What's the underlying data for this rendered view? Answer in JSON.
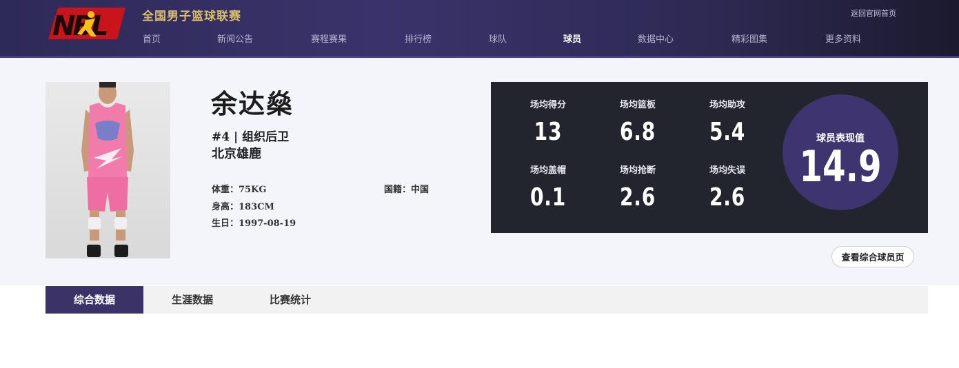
{
  "header": {
    "league_title": "全国男子篮球联赛",
    "back_link": "返回官网首页",
    "nav": [
      {
        "label": "首页",
        "active": false
      },
      {
        "label": "新闻公告",
        "active": false
      },
      {
        "label": "赛程赛果",
        "active": false
      },
      {
        "label": "排行榜",
        "active": false
      },
      {
        "label": "球队",
        "active": false
      },
      {
        "label": "球员",
        "active": true
      },
      {
        "label": "数据中心",
        "active": false
      },
      {
        "label": "精彩图集",
        "active": false
      },
      {
        "label": "更多资料",
        "active": false
      }
    ]
  },
  "player": {
    "name": "余达燊",
    "number_position": "#4 | 组织后卫",
    "team": "北京雄鹿",
    "weight": "体重：75KG",
    "height": "身高：183CM",
    "birthday": "生日：1997-08-19",
    "nationality": "国籍：中国"
  },
  "stats": [
    {
      "label": "场均得分",
      "value": "13"
    },
    {
      "label": "场均篮板",
      "value": "6.8"
    },
    {
      "label": "场均助攻",
      "value": "5.4"
    },
    {
      "label": "场均盖帽",
      "value": "0.1"
    },
    {
      "label": "场均抢断",
      "value": "2.6"
    },
    {
      "label": "场均失误",
      "value": "2.6"
    }
  ],
  "rating": {
    "label": "球员表现值",
    "value": "14.9"
  },
  "more_button": "查看综合球员页",
  "tabs": [
    {
      "label": "综合数据",
      "active": true
    },
    {
      "label": "生涯数据",
      "active": false
    },
    {
      "label": "比赛统计",
      "active": false
    }
  ],
  "colors": {
    "header_bg": "#2e2a57",
    "accent": "#3b3268",
    "stats_bg": "#23252e",
    "title_gold": "#d9bd6a",
    "logo_red": "#c8141a"
  }
}
